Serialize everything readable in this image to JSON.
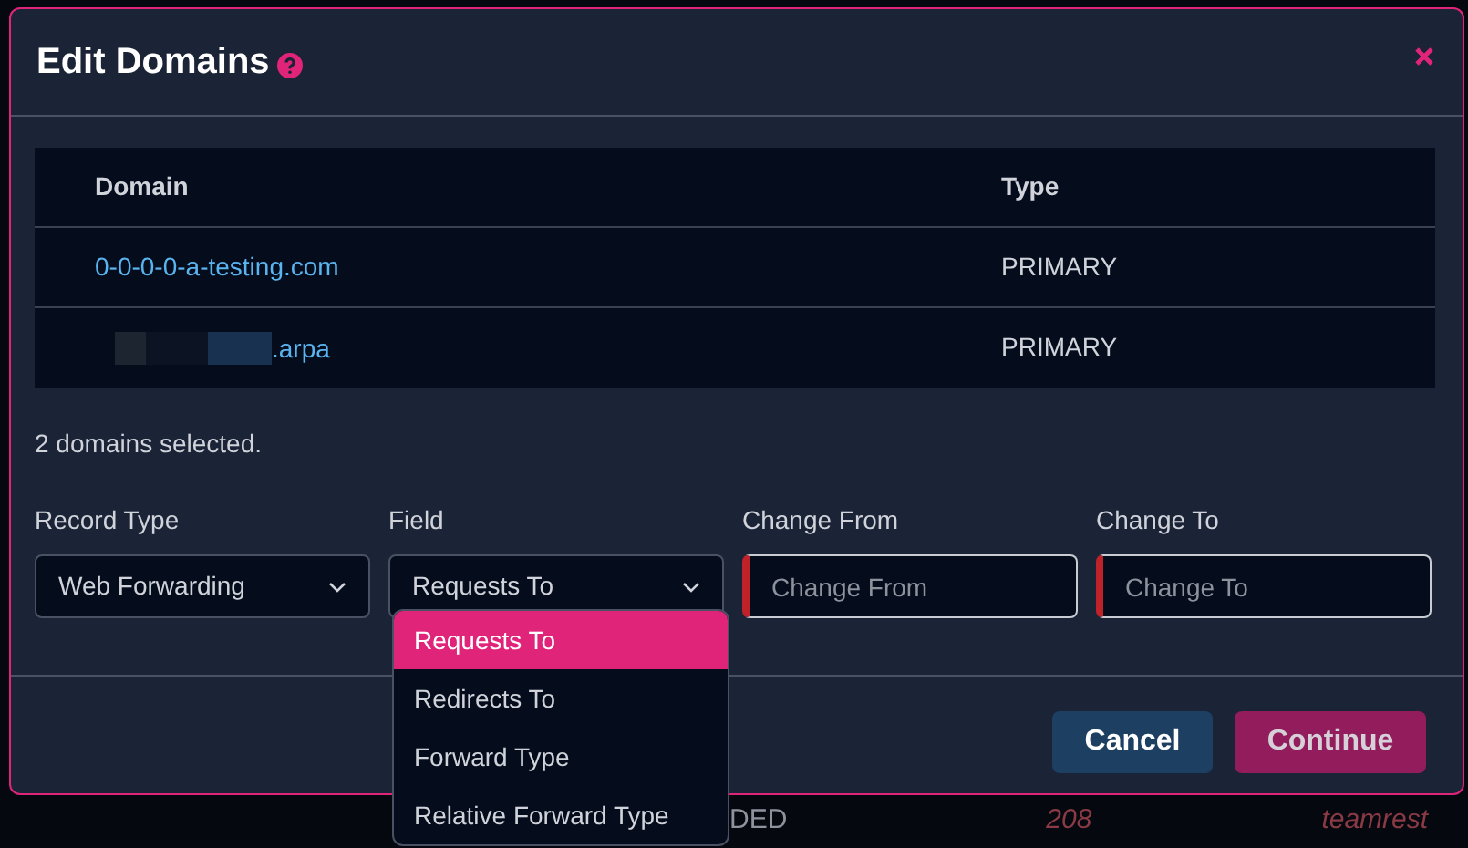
{
  "dialog": {
    "title": "Edit Domains"
  },
  "table": {
    "columns": [
      "Domain",
      "Type"
    ],
    "rows": [
      {
        "domain": "0-0-0-0-a-testing.com",
        "redacted": false,
        "type": "PRIMARY"
      },
      {
        "domain": ".arpa",
        "redacted": true,
        "type": "PRIMARY"
      }
    ]
  },
  "summary": "2 domains selected.",
  "fields": [
    {
      "kind": "select",
      "label": "Record Type",
      "value": "Web Forwarding"
    },
    {
      "kind": "select",
      "label": "Field",
      "value": "Requests To",
      "expanded": true
    },
    {
      "kind": "text",
      "label": "Change From",
      "placeholder": "Change From",
      "invalid": true
    },
    {
      "kind": "text",
      "label": "Change To",
      "placeholder": "Change To",
      "invalid": true
    }
  ],
  "dropdown_options": [
    {
      "label": "Requests To",
      "selected": true
    },
    {
      "label": "Redirects To",
      "selected": false
    },
    {
      "label": "Forward Type",
      "selected": false
    },
    {
      "label": "Relative Forward Type",
      "selected": false
    }
  ],
  "buttons": [
    {
      "kind": "secondary",
      "label": "Cancel"
    },
    {
      "kind": "primary",
      "label": "Continue"
    }
  ],
  "background_row": [
    "DED",
    "208",
    "teamrest"
  ]
}
